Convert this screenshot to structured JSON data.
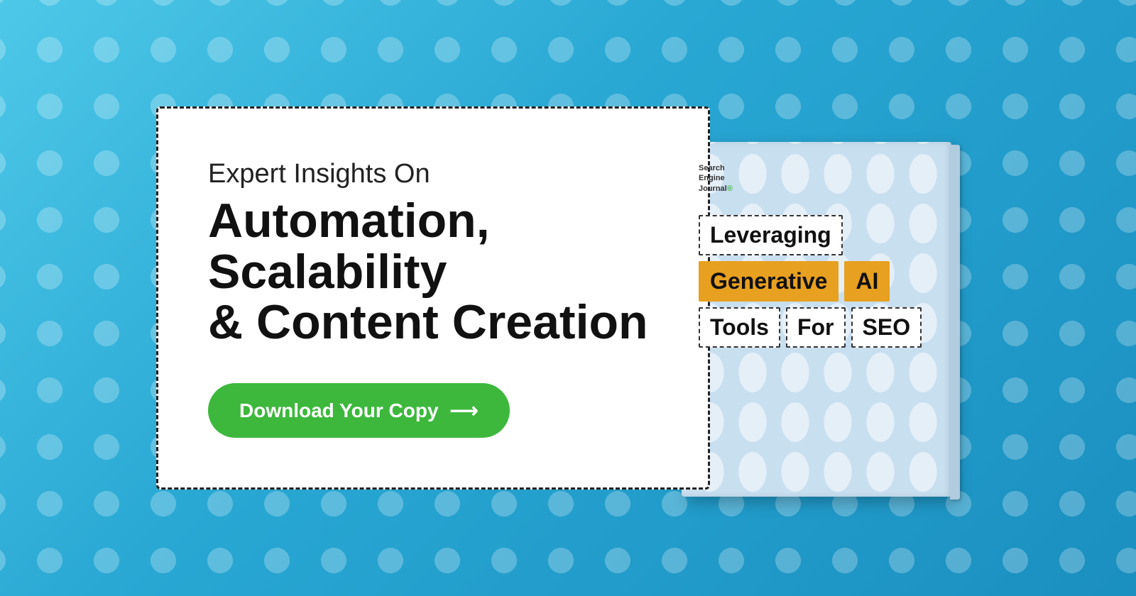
{
  "background": {
    "gradient_start": "#4ec8e8",
    "gradient_end": "#1a8fc0"
  },
  "card": {
    "subtitle": "Expert Insights On",
    "title_line1": "Automation, Scalability",
    "title_line2": "& Content Creation",
    "button_label": "Download Your Copy",
    "button_arrow": "⟶"
  },
  "book": {
    "brand_line1": "Search",
    "brand_line2": "Engine",
    "brand_line3": "Journal",
    "brand_trademark": "®",
    "title_word1": "Leveraging",
    "title_word2": "Generative",
    "title_word3": "AI",
    "title_word4": "Tools",
    "title_word5": "For",
    "title_word6": "SEO"
  }
}
